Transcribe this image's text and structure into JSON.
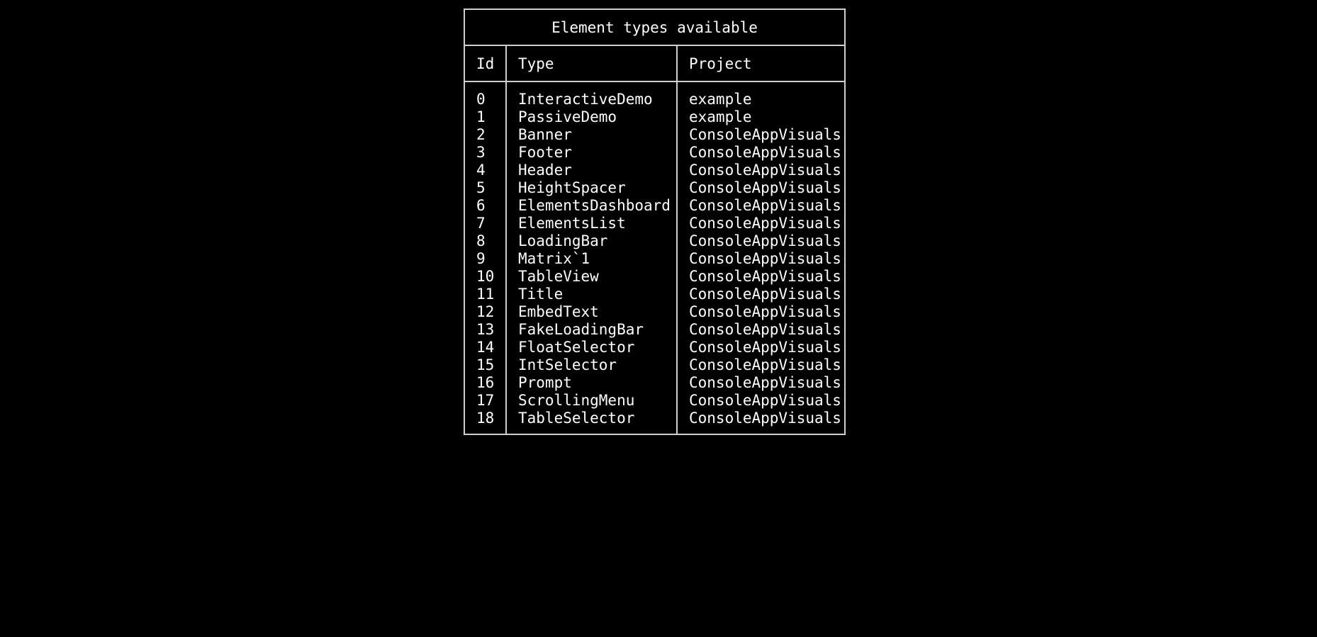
{
  "table": {
    "title": "Element types available",
    "headers": {
      "id": "Id",
      "type": "Type",
      "project": "Project"
    },
    "rows": [
      {
        "id": "0",
        "type": "InteractiveDemo",
        "project": "example"
      },
      {
        "id": "1",
        "type": "PassiveDemo",
        "project": "example"
      },
      {
        "id": "2",
        "type": "Banner",
        "project": "ConsoleAppVisuals"
      },
      {
        "id": "3",
        "type": "Footer",
        "project": "ConsoleAppVisuals"
      },
      {
        "id": "4",
        "type": "Header",
        "project": "ConsoleAppVisuals"
      },
      {
        "id": "5",
        "type": "HeightSpacer",
        "project": "ConsoleAppVisuals"
      },
      {
        "id": "6",
        "type": "ElementsDashboard",
        "project": "ConsoleAppVisuals"
      },
      {
        "id": "7",
        "type": "ElementsList",
        "project": "ConsoleAppVisuals"
      },
      {
        "id": "8",
        "type": "LoadingBar",
        "project": "ConsoleAppVisuals"
      },
      {
        "id": "9",
        "type": "Matrix`1",
        "project": "ConsoleAppVisuals"
      },
      {
        "id": "10",
        "type": "TableView",
        "project": "ConsoleAppVisuals"
      },
      {
        "id": "11",
        "type": "Title",
        "project": "ConsoleAppVisuals"
      },
      {
        "id": "12",
        "type": "EmbedText",
        "project": "ConsoleAppVisuals"
      },
      {
        "id": "13",
        "type": "FakeLoadingBar",
        "project": "ConsoleAppVisuals"
      },
      {
        "id": "14",
        "type": "FloatSelector",
        "project": "ConsoleAppVisuals"
      },
      {
        "id": "15",
        "type": "IntSelector",
        "project": "ConsoleAppVisuals"
      },
      {
        "id": "16",
        "type": "Prompt",
        "project": "ConsoleAppVisuals"
      },
      {
        "id": "17",
        "type": "ScrollingMenu",
        "project": "ConsoleAppVisuals"
      },
      {
        "id": "18",
        "type": "TableSelector",
        "project": "ConsoleAppVisuals"
      }
    ]
  }
}
